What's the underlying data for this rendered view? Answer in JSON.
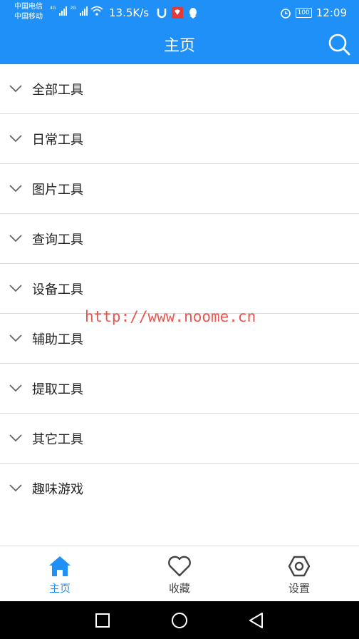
{
  "status_bar": {
    "carrier_1": "中国电信",
    "carrier_2": "中国移动",
    "net_1": "4G",
    "net_2": "2G",
    "speed": "13.5K/s",
    "battery": "100",
    "time": "12:09"
  },
  "app_bar": {
    "title": "主页"
  },
  "categories": [
    {
      "label": "全部工具"
    },
    {
      "label": "日常工具"
    },
    {
      "label": "图片工具"
    },
    {
      "label": "查询工具"
    },
    {
      "label": "设备工具"
    },
    {
      "label": "辅助工具"
    },
    {
      "label": "提取工具"
    },
    {
      "label": "其它工具"
    },
    {
      "label": "趣味游戏"
    }
  ],
  "watermark": "http://www.noome.cn",
  "bottom_nav": {
    "home": {
      "label": "主页",
      "active": true
    },
    "favorites": {
      "label": "收藏",
      "active": false
    },
    "settings": {
      "label": "设置",
      "active": false
    }
  },
  "colors": {
    "primary": "#1e90f8",
    "inactive": "#444444",
    "watermark": "#e53935"
  }
}
